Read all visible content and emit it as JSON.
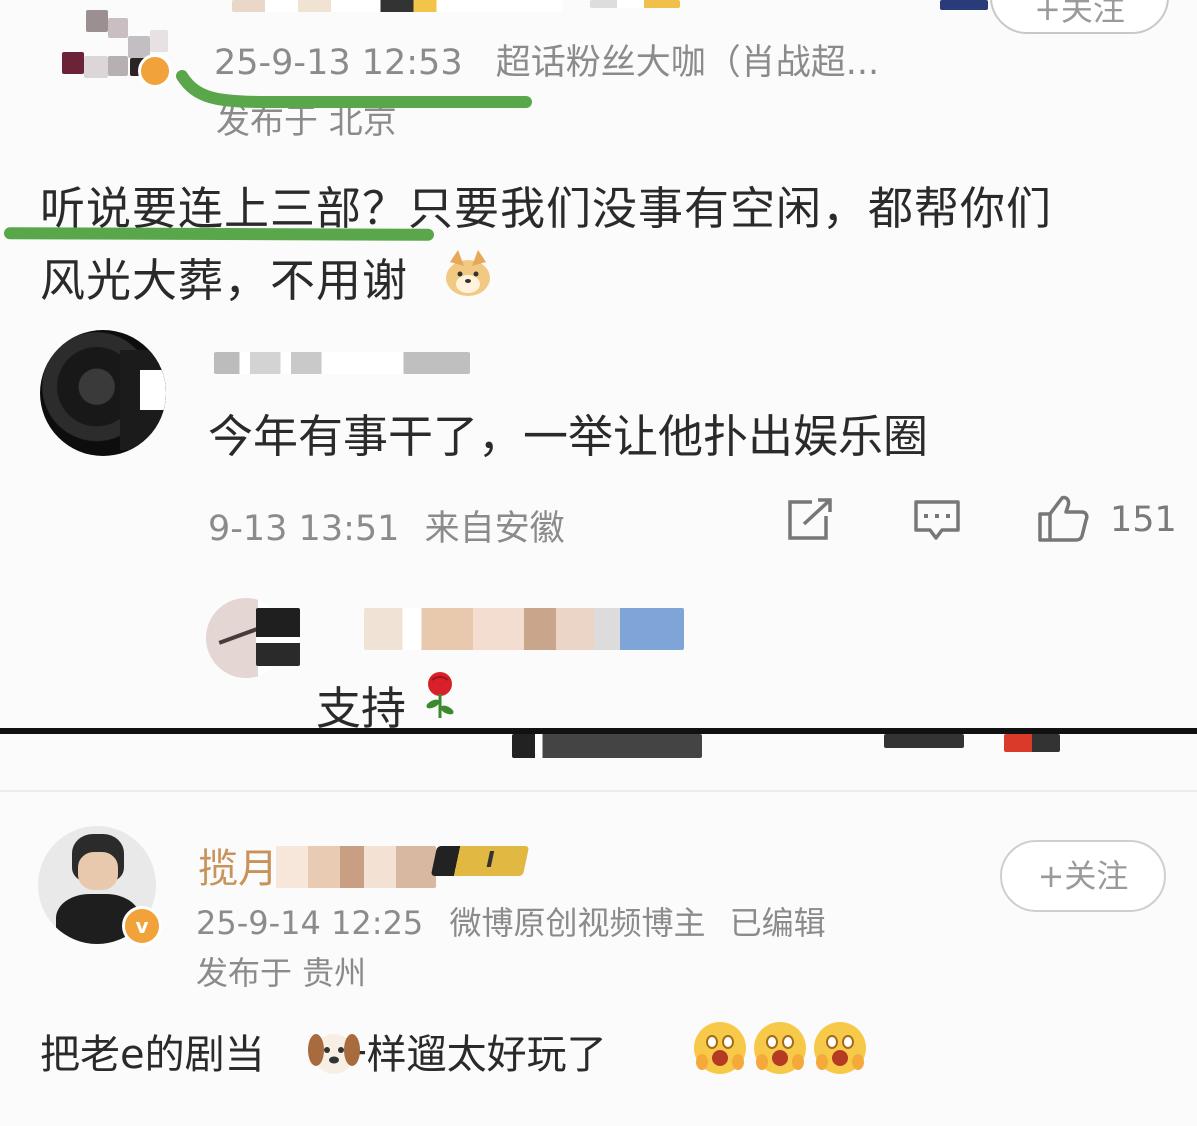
{
  "top_post": {
    "timestamp": "25-9-13 12:53",
    "badge_text": "超话粉丝大咖（肖战超...",
    "location": "发布于 北京",
    "follow_label": "+关注",
    "content_line1_a": "听说要连上三部？",
    "content_line1_b": "只要我们没事有空闲，都帮你们",
    "content_line2": "风光大葬，不用谢"
  },
  "reply": {
    "text": "今年有事干了，一举让他扑出娱乐圈",
    "timestamp": "9-13 13:51",
    "location": "来自安徽",
    "like_count": "151"
  },
  "sub_reply": {
    "text": "支持"
  },
  "bottom_post": {
    "username_prefix": "揽月",
    "level_badge": "I",
    "follow_label": "+关注",
    "timestamp": "25-9-14 12:25",
    "source": "微博原创视频博主",
    "edited": "已编辑",
    "location": "发布于 贵州",
    "content_a": "把老e的剧当",
    "content_b": "一样遛太好玩了"
  },
  "colors": {
    "highlight_green": "#5aa64a",
    "meta_gray": "#8b8b8b",
    "orange_name": "#c8935b",
    "verified_orange": "#f2a23a"
  }
}
